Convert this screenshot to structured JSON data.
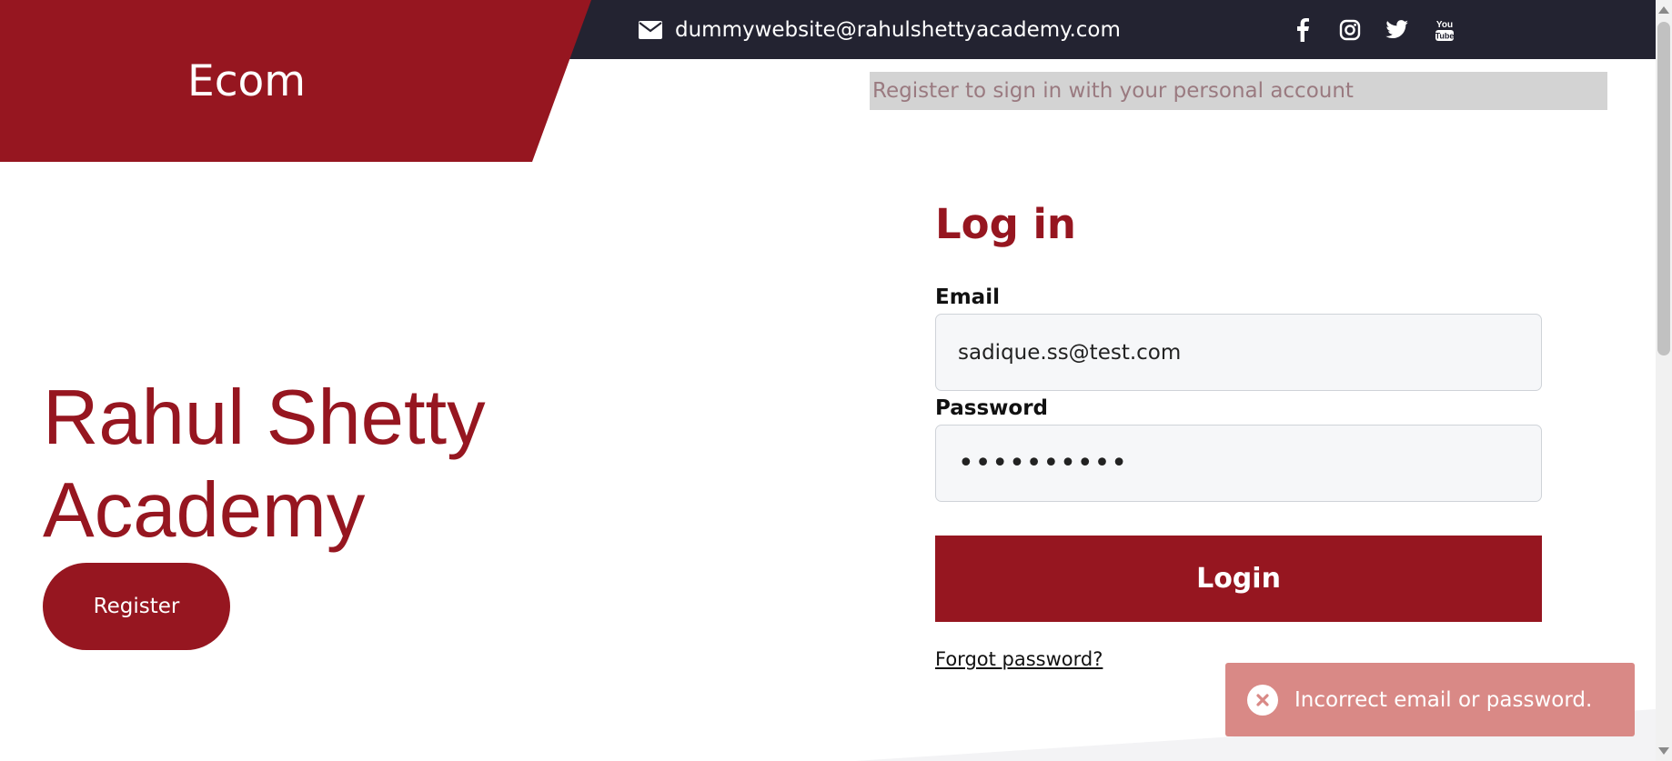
{
  "header": {
    "brand": "Ecom",
    "contact_email": "dummywebsite@rahulshettyacademy.com",
    "social_icons": [
      "facebook-icon",
      "instagram-icon",
      "twitter-icon",
      "youtube-icon"
    ],
    "youtube_icon_text": [
      "You",
      "Tube"
    ]
  },
  "banner": {
    "text": "Register to sign in with your personal account"
  },
  "hero": {
    "title": "Rahul Shetty Academy",
    "register_label": "Register"
  },
  "login": {
    "title": "Log in",
    "email_label": "Email",
    "email_value": "sadique.ss@test.com",
    "password_label": "Password",
    "password_value": "••••••••••",
    "login_label": "Login",
    "forgot_label": "Forgot password?"
  },
  "toast": {
    "message": "Incorrect email or password.",
    "icon": "error-x-icon"
  },
  "colors": {
    "brand": "#961620",
    "topbar": "#232331",
    "toast_bg": "#d98986",
    "banner_bg": "#d3d3d3"
  }
}
